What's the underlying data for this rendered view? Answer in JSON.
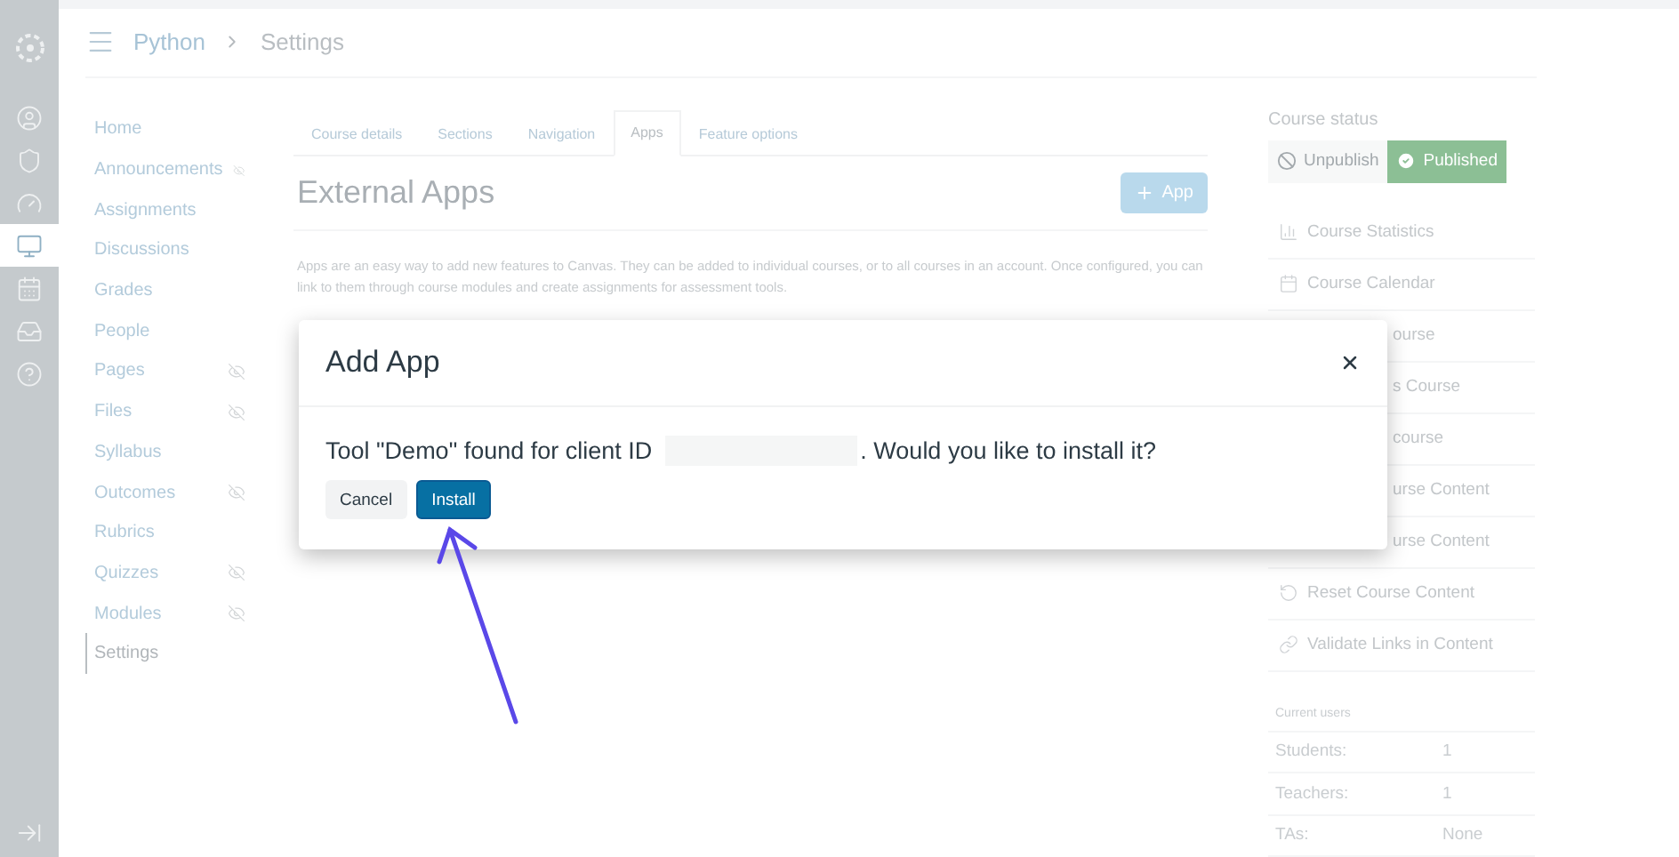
{
  "global_nav": {
    "items": [
      {
        "kind": "logo",
        "selected": false
      },
      {
        "kind": "account",
        "selected": false
      },
      {
        "kind": "admin",
        "selected": false
      },
      {
        "kind": "dashboard",
        "selected": false
      },
      {
        "kind": "courses",
        "selected": true
      },
      {
        "kind": "calendar",
        "selected": false
      },
      {
        "kind": "inbox",
        "selected": false
      },
      {
        "kind": "help",
        "selected": false
      }
    ]
  },
  "breadcrumb": [
    "Python",
    "Settings"
  ],
  "course_nav": [
    {
      "label": "Home",
      "hidden": false,
      "selected": false
    },
    {
      "label": "Announcements",
      "hidden": true,
      "selected": false
    },
    {
      "label": "Assignments",
      "hidden": false,
      "selected": false
    },
    {
      "label": "Discussions",
      "hidden": false,
      "selected": false
    },
    {
      "label": "Grades",
      "hidden": false,
      "selected": false
    },
    {
      "label": "People",
      "hidden": false,
      "selected": false
    },
    {
      "label": "Pages",
      "hidden": true,
      "selected": false
    },
    {
      "label": "Files",
      "hidden": true,
      "selected": false
    },
    {
      "label": "Syllabus",
      "hidden": false,
      "selected": false
    },
    {
      "label": "Outcomes",
      "hidden": true,
      "selected": false
    },
    {
      "label": "Rubrics",
      "hidden": false,
      "selected": false
    },
    {
      "label": "Quizzes",
      "hidden": true,
      "selected": false
    },
    {
      "label": "Modules",
      "hidden": true,
      "selected": false
    },
    {
      "label": "Settings",
      "hidden": false,
      "selected": true
    }
  ],
  "tabs": [
    {
      "label": "Course details",
      "selected": false
    },
    {
      "label": "Sections",
      "selected": false
    },
    {
      "label": "Navigation",
      "selected": false
    },
    {
      "label": "Apps",
      "selected": true
    },
    {
      "label": "Feature options",
      "selected": false
    }
  ],
  "heading": "External Apps",
  "add_app_button": "App",
  "description": "Apps are an easy way to add new features to Canvas. They can be added to individual courses, or to all courses in an account. Once configured, you can link to them through course modules and create assignments for assessment tools.",
  "course_status": {
    "title": "Course status",
    "buttons": [
      {
        "label": "Unpublish",
        "kind": "unpublish",
        "selected": false
      },
      {
        "label": "Published",
        "kind": "published",
        "selected": true
      }
    ]
  },
  "sidebar_links": [
    {
      "label": "Course Statistics",
      "kind": "stats"
    },
    {
      "label": "Course Calendar",
      "kind": "calendar"
    },
    {
      "label": "ourse",
      "kind": "covered"
    },
    {
      "label": "s Course",
      "kind": "covered"
    },
    {
      "label": "course",
      "kind": "covered"
    },
    {
      "label": "urse Content",
      "kind": "covered"
    },
    {
      "label": "urse Content",
      "kind": "covered"
    },
    {
      "label": "Reset Course Content",
      "kind": "reset"
    },
    {
      "label": "Validate Links in Content",
      "kind": "link"
    }
  ],
  "current_users": {
    "title": "Current users",
    "rows": [
      {
        "role": "Students:",
        "count": "1"
      },
      {
        "role": "Teachers:",
        "count": "1"
      },
      {
        "role": "TAs:",
        "count": "None"
      }
    ]
  },
  "dialog": {
    "title": "Add App",
    "message_before": "Tool \"Demo\" found for client ID",
    "message_after": ". Would you like to install it?",
    "buttons": [
      {
        "label": "Cancel",
        "kind": "secondary"
      },
      {
        "label": "Install",
        "kind": "primary"
      }
    ]
  }
}
